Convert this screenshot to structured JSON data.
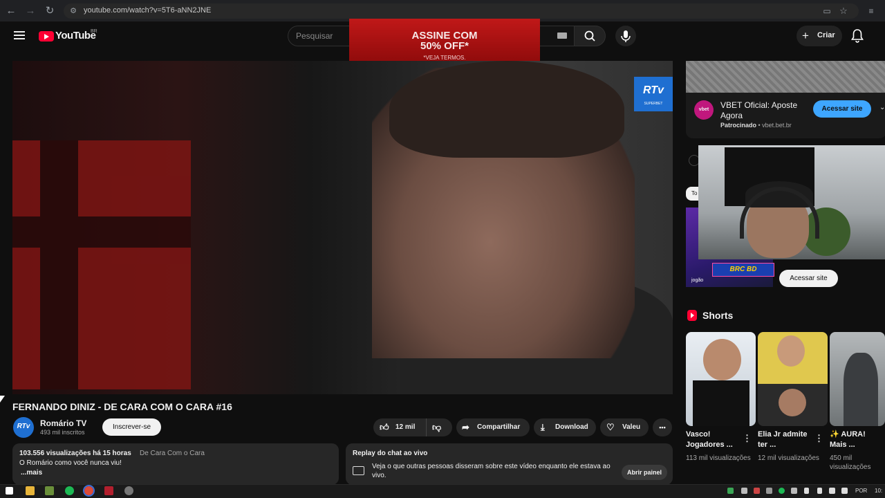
{
  "browser": {
    "url": "youtube.com/watch?v=5T6-aNN2JNE"
  },
  "header": {
    "logo_text": "YouTube",
    "country_code": "BR",
    "search_placeholder": "Pesquisar",
    "create_label": "Criar"
  },
  "top_ad": {
    "line1": "ASSINE COM",
    "line2": "50% OFF*",
    "line3": "*VEJA TERMOS."
  },
  "video": {
    "overlay_logo": "RTv",
    "overlay_sub": "SUPERBET",
    "title": "FERNANDO DINIZ - DE CARA COM O CARA #16"
  },
  "channel": {
    "avatar_text": "RTv",
    "name": "Romário TV",
    "subscribers": "493 mil inscritos",
    "subscribe_label": "Inscrever-se"
  },
  "actions": {
    "likes": "12 mil",
    "share": "Compartilhar",
    "download": "Download",
    "thanks": "Valeu",
    "more": "•••"
  },
  "description": {
    "views": "103.556 visualizações  há 15 horas",
    "tag": "De Cara Com o Cara",
    "text": "O Romário como você nunca viu!",
    "more": "...mais"
  },
  "chat_replay": {
    "title": "Replay do chat ao vivo",
    "text": "Veja o que outras pessoas disseram sobre este vídeo enquanto ele estava ao vivo.",
    "button": "Abrir painel"
  },
  "sidebar_ad": {
    "logo": "vbet",
    "title": "VBET Oficial: Aposte Agora",
    "sponsored": "Patrocinado",
    "domain": "vbet.bet.br",
    "button": "Acessar site"
  },
  "overlay_ad": {
    "brand": "BRC BD",
    "jogao": "jogão",
    "button": "Acessar site",
    "chip": "To"
  },
  "shorts": {
    "title": "Shorts",
    "items": [
      {
        "title": "Vasco! Jogadores ...",
        "views": "113 mil visualizações",
        "thumb_color": "#dfe6ee"
      },
      {
        "title": "Elia Jr admite ter ...",
        "views": "12 mil visualizações",
        "thumb_color": "#d8c24a"
      },
      {
        "title": "✨ AURA! Mais ...",
        "views": "450 mil visualizações",
        "thumb_color": "#8e9294"
      }
    ]
  },
  "taskbar": {
    "lang": "POR",
    "clock": "10:"
  }
}
